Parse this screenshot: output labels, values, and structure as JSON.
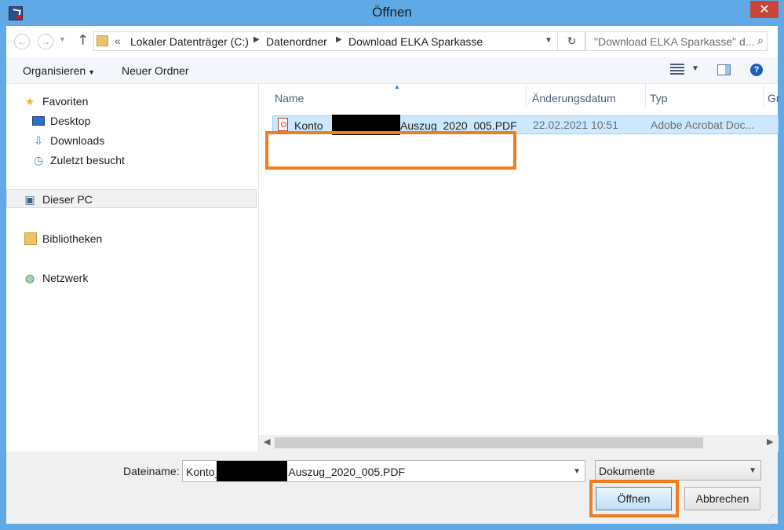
{
  "window": {
    "title": "Öffnen",
    "close_glyph": "✕",
    "app_icon": "app-icon"
  },
  "address": {
    "overflow": "«",
    "crumbs": [
      "Lokaler Datenträger (C:)",
      "Datenordner",
      "Download ELKA Sparkasse"
    ],
    "search_placeholder": "\"Download ELKA Sparkasse\" d...",
    "back_glyph": "←",
    "forward_glyph": "→",
    "up_glyph": "↑",
    "refresh_glyph": "↻",
    "search_glyph": "⌕"
  },
  "toolbar": {
    "organize": "Organisieren",
    "new_folder": "Neuer Ordner",
    "help_glyph": "?"
  },
  "nav": {
    "favorites": "Favoriten",
    "desktop": "Desktop",
    "downloads": "Downloads",
    "recent": "Zuletzt besucht",
    "this_pc": "Dieser PC",
    "libraries": "Bibliotheken",
    "network": "Netzwerk"
  },
  "columns": {
    "name": "Name",
    "date": "Änderungsdatum",
    "type": "Typ",
    "size": "Gr"
  },
  "files": [
    {
      "name_prefix": "Konto_",
      "name_suffix": "-Auszug_2020_005.PDF",
      "date": "22.02.2021 10:51",
      "type": "Adobe Acrobat Doc...",
      "icon": "pdf-icon"
    }
  ],
  "footer": {
    "filename_label": "Dateiname:",
    "filename_prefix": "Konto_",
    "filename_suffix": "Auszug_2020_005.PDF",
    "filter": "Dokumente",
    "open": "Öffnen",
    "cancel": "Abbrechen"
  },
  "colors": {
    "frame": "#5fa9e6",
    "close": "#c7463c",
    "selection": "#cce8ff",
    "highlight": "#f07d1e"
  }
}
